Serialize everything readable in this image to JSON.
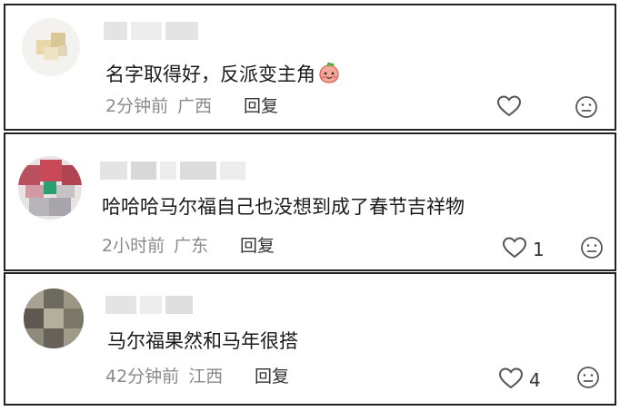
{
  "comments": [
    {
      "text": "名字取得好，反派变主角",
      "emoji": "blushing-peach-emoji",
      "time": "2分钟前",
      "location": "广西",
      "reply_label": "回复",
      "likes": ""
    },
    {
      "text": "哈哈哈马尔福自己也没想到成了春节吉祥物",
      "time": "2小时前",
      "location": "广东",
      "reply_label": "回复",
      "likes": "1"
    },
    {
      "text": "马尔福果然和马年很搭",
      "time": "42分钟前",
      "location": "江西",
      "reply_label": "回复",
      "likes": "4"
    }
  ],
  "icons": {
    "like": "heart-outline-icon",
    "dislike": "unhappy-face-icon"
  },
  "colors": {
    "text": "#1a1a1a",
    "meta": "#8a8a8a",
    "border": "#222222",
    "icon": "#555555"
  }
}
